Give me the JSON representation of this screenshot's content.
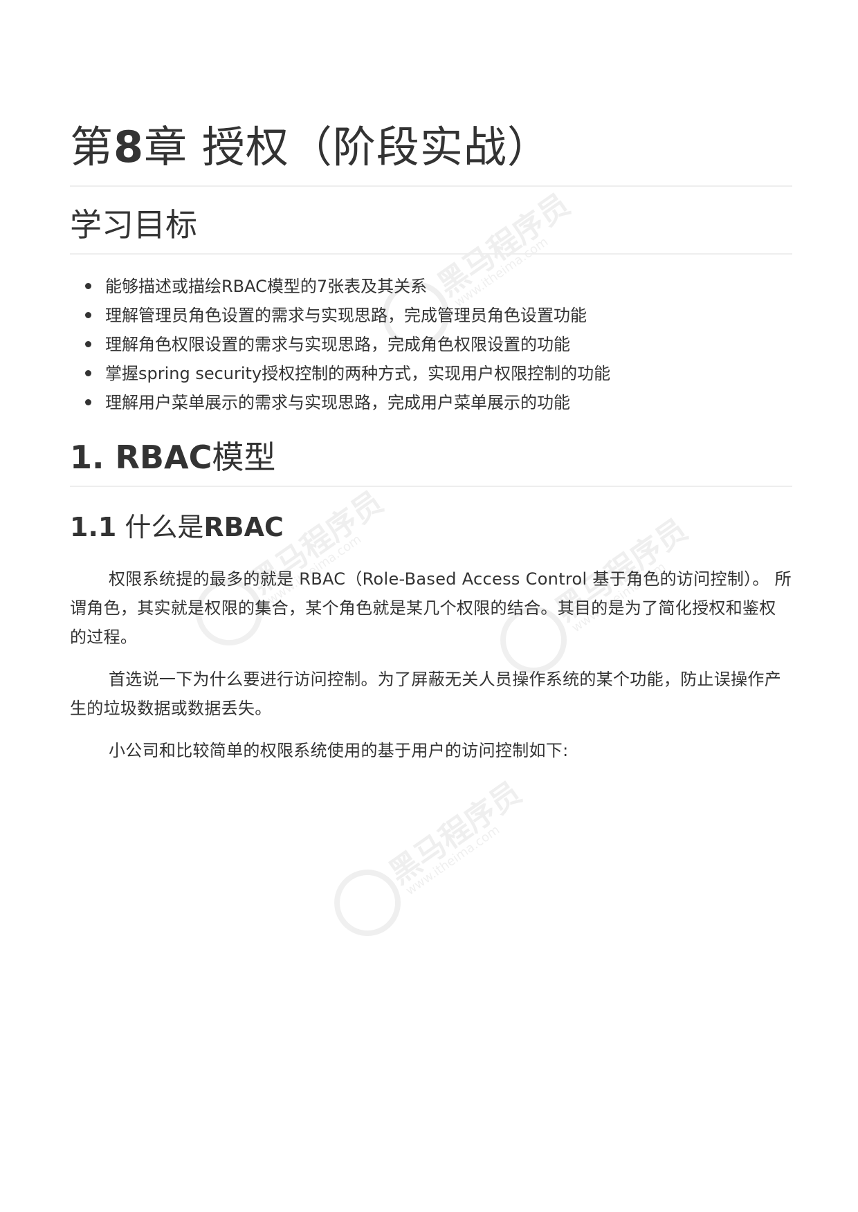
{
  "chapter": {
    "prefix": "第",
    "number": "8",
    "suffix": "章 授权（阶段实战）"
  },
  "objectives": {
    "title": "学习目标",
    "items": [
      "能够描述或描绘RBAC模型的7张表及其关系",
      "理解管理员角色设置的需求与实现思路，完成管理员角色设置功能",
      "理解角色权限设置的需求与实现思路，完成角色权限设置的功能",
      "掌握spring security授权控制的两种方式，实现用户权限控制的功能",
      "理解用户菜单展示的需求与实现思路，完成用户菜单展示的功能"
    ]
  },
  "section1": {
    "number": "1. RBAC",
    "title": "模型"
  },
  "section1_1": {
    "number": "1.1",
    "title": " 什么是",
    "title_bold": "RBAC"
  },
  "paragraphs": [
    "权限系统提的最多的就是 RBAC（Role-Based Access Control 基于角色的访问控制）。 所谓角色，其实就是权限的集合，某个角色就是某几个权限的结合。其目的是为了简化授权和鉴权的过程。",
    "首选说一下为什么要进行访问控制。为了屏蔽无关人员操作系统的某个功能，防止误操作产生的垃圾数据或数据丢失。",
    "小公司和比较简单的权限系统使用的基于用户的访问控制如下:"
  ],
  "watermark": {
    "brand": "黑马程序员",
    "url": "www.itheima.com"
  }
}
